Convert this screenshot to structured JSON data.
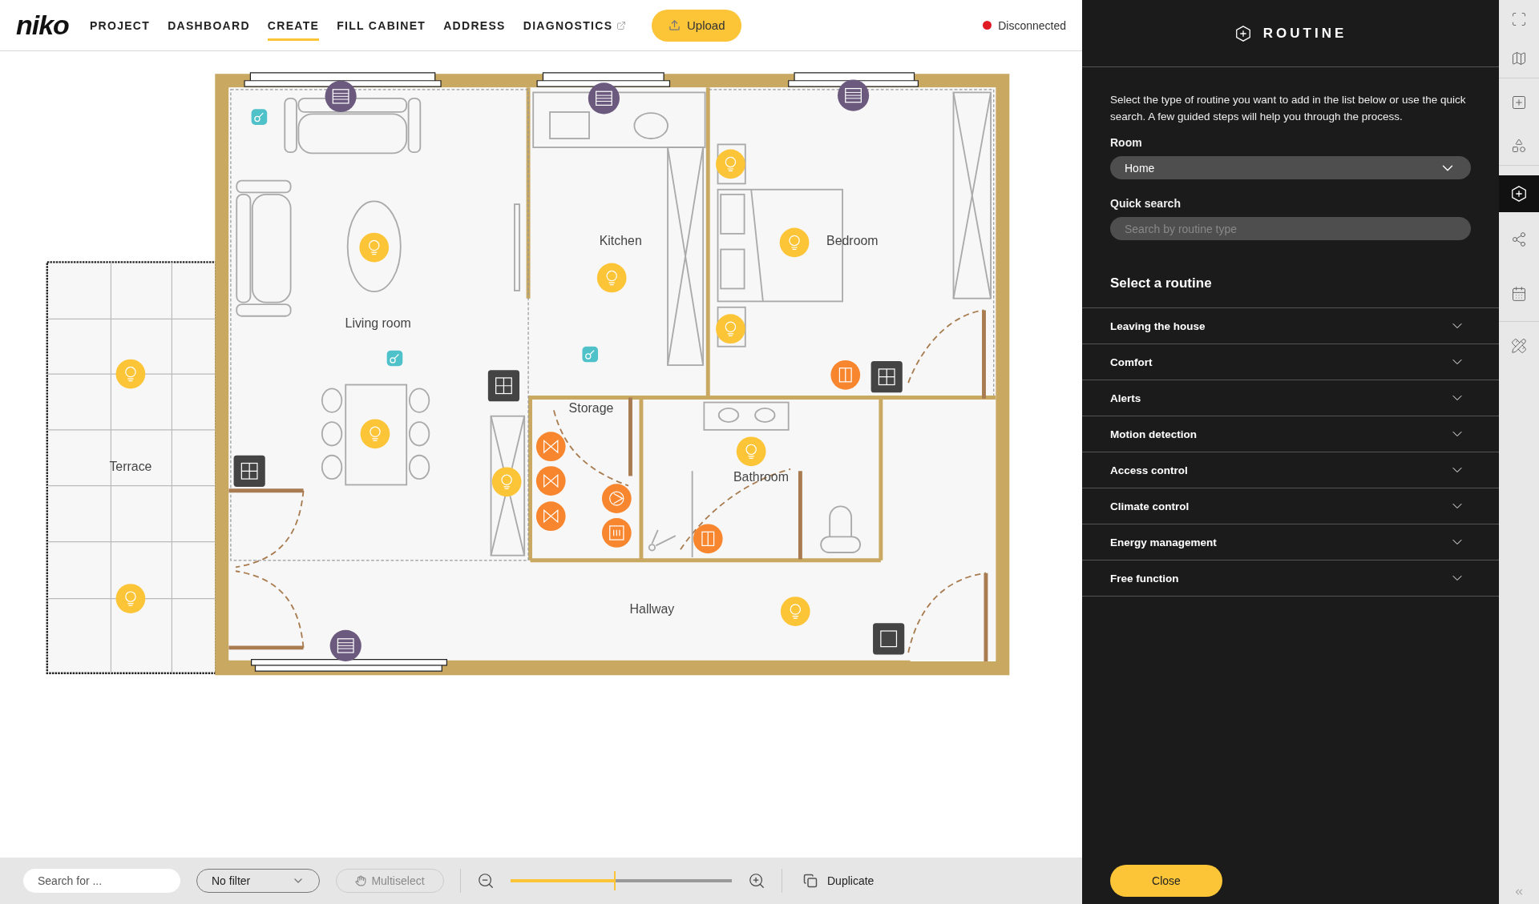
{
  "nav": {
    "logo": "niko",
    "items": [
      {
        "label": "PROJECT",
        "selected": false,
        "external": false
      },
      {
        "label": "DASHBOARD",
        "selected": false,
        "external": false
      },
      {
        "label": "CREATE",
        "selected": true,
        "external": false
      },
      {
        "label": "FILL CABINET",
        "selected": false,
        "external": false
      },
      {
        "label": "ADDRESS",
        "selected": false,
        "external": false
      },
      {
        "label": "DIAGNOSTICS",
        "selected": false,
        "external": true
      }
    ],
    "upload": "Upload",
    "status": {
      "label": "Disconnected",
      "connected": false
    }
  },
  "floorplan": {
    "rooms": [
      {
        "name": "Living room"
      },
      {
        "name": "Kitchen"
      },
      {
        "name": "Bedroom"
      },
      {
        "name": "Terrace"
      },
      {
        "name": "Storage"
      },
      {
        "name": "Bathroom"
      },
      {
        "name": "Hallway"
      }
    ]
  },
  "toolbar": {
    "search_placeholder": "Search for ...",
    "filter": "No filter",
    "multiselect": {
      "label": "Multiselect",
      "disabled": true
    },
    "zoom": {
      "level": 0.47
    },
    "duplicate": "Duplicate"
  },
  "panel": {
    "title": "ROUTINE",
    "intro": "Select the type of routine you want to add in the list below or use the quick search. A few guided steps will help you through the process.",
    "room_label": "Room",
    "room_value": "Home",
    "search_label": "Quick search",
    "search_placeholder": "Search by routine type",
    "section_title": "Select a routine",
    "routines": [
      {
        "label": "Leaving the house",
        "expanded": false
      },
      {
        "label": "Comfort",
        "expanded": false
      },
      {
        "label": "Alerts",
        "expanded": false
      },
      {
        "label": "Motion detection",
        "expanded": false
      },
      {
        "label": "Access control",
        "expanded": false
      },
      {
        "label": "Climate control",
        "expanded": false
      },
      {
        "label": "Energy management",
        "expanded": false
      },
      {
        "label": "Free function",
        "expanded": false
      }
    ],
    "close": "Close"
  },
  "side_tools": [
    {
      "selected": false
    },
    {
      "selected": false
    },
    {
      "selected": false
    },
    {
      "selected": false
    },
    {
      "selected": true
    },
    {
      "selected": false
    },
    {
      "selected": false
    },
    {
      "selected": false
    }
  ]
}
